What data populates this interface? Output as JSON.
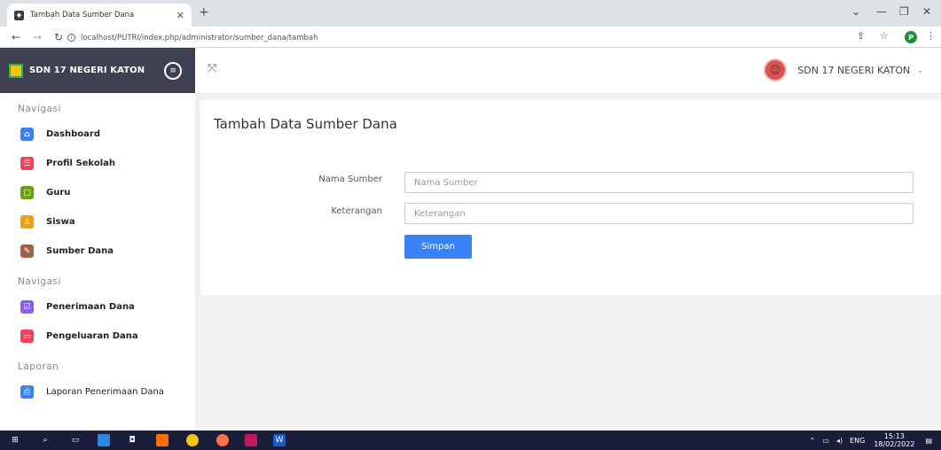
{
  "browser": {
    "tab_title": "Tambah Data Sumber Dana",
    "url": "localhost/PUTRI/index.php/administrator/sumber_dana/tambah",
    "profile_initial": "P"
  },
  "app": {
    "brand": "SDN 17 NEGERI KATON",
    "user_name": "SDN 17 NEGERI KATON"
  },
  "sidebar": {
    "sections": [
      {
        "heading": "Navigasi",
        "items": [
          {
            "label": "Dashboard",
            "icon": "home-icon",
            "color": "#3b82f6"
          },
          {
            "label": "Profil Sekolah",
            "icon": "list-icon",
            "color": "#f43f5e"
          },
          {
            "label": "Guru",
            "icon": "calendar-icon",
            "color": "#65a30d"
          },
          {
            "label": "Siswa",
            "icon": "user-icon",
            "color": "#f59e0b"
          },
          {
            "label": "Sumber Dana",
            "icon": "edit-icon",
            "color": "#a16246"
          }
        ]
      },
      {
        "heading": "Navigasi",
        "items": [
          {
            "label": "Penerimaan Dana",
            "icon": "check-edit-icon",
            "color": "#8b5cf6"
          },
          {
            "label": "Pengeluaran Dana",
            "icon": "chat-icon",
            "color": "#f43f5e"
          }
        ]
      },
      {
        "heading": "Laporan",
        "items": [
          {
            "label": "Laporan Penerimaan Dana",
            "icon": "printer-icon",
            "color": "#3b82f6"
          }
        ]
      }
    ]
  },
  "form": {
    "title": "Tambah Data Sumber Dana",
    "fields": [
      {
        "label": "Nama Sumber",
        "placeholder": "Nama Sumber",
        "value": ""
      },
      {
        "label": "Keterangan",
        "placeholder": "Keterangan",
        "value": ""
      }
    ],
    "submit_label": "Simpan"
  },
  "taskbar": {
    "language": "ENG",
    "time": "15:13",
    "date": "18/02/2022"
  }
}
